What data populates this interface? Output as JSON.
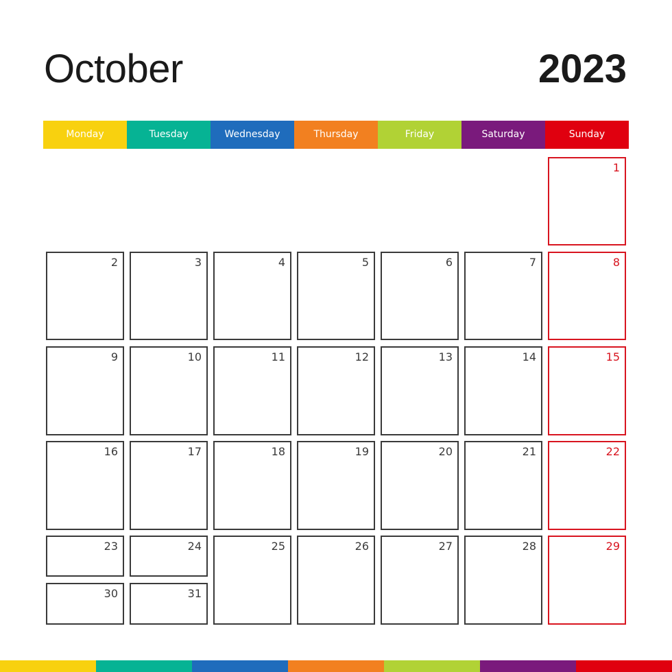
{
  "header": {
    "month": "October",
    "year": "2023"
  },
  "weekdays": [
    {
      "label": "Monday",
      "color": "#f8d10f"
    },
    {
      "label": "Tuesday",
      "color": "#06b394"
    },
    {
      "label": "Wednesday",
      "color": "#1f6cbc"
    },
    {
      "label": "Thursday",
      "color": "#f28020"
    },
    {
      "label": "Friday",
      "color": "#b1d235"
    },
    {
      "label": "Saturday",
      "color": "#7a1a7c"
    },
    {
      "label": "Sunday",
      "color": "#e0000f"
    }
  ],
  "colors": {
    "sunday_border": "#d8141f",
    "cell_border": "#3a3a3a",
    "text": "#1a1a1a"
  },
  "days": [
    {
      "day": "1",
      "col": 6,
      "row": 0
    },
    {
      "day": "2",
      "col": 0,
      "row": 1
    },
    {
      "day": "3",
      "col": 1,
      "row": 1
    },
    {
      "day": "4",
      "col": 2,
      "row": 1
    },
    {
      "day": "5",
      "col": 3,
      "row": 1
    },
    {
      "day": "6",
      "col": 4,
      "row": 1
    },
    {
      "day": "7",
      "col": 5,
      "row": 1
    },
    {
      "day": "8",
      "col": 6,
      "row": 1
    },
    {
      "day": "9",
      "col": 0,
      "row": 2
    },
    {
      "day": "10",
      "col": 1,
      "row": 2
    },
    {
      "day": "11",
      "col": 2,
      "row": 2
    },
    {
      "day": "12",
      "col": 3,
      "row": 2
    },
    {
      "day": "13",
      "col": 4,
      "row": 2
    },
    {
      "day": "14",
      "col": 5,
      "row": 2
    },
    {
      "day": "15",
      "col": 6,
      "row": 2
    },
    {
      "day": "16",
      "col": 0,
      "row": 3
    },
    {
      "day": "17",
      "col": 1,
      "row": 3
    },
    {
      "day": "18",
      "col": 2,
      "row": 3
    },
    {
      "day": "19",
      "col": 3,
      "row": 3
    },
    {
      "day": "20",
      "col": 4,
      "row": 3
    },
    {
      "day": "21",
      "col": 5,
      "row": 3
    },
    {
      "day": "22",
      "col": 6,
      "row": 3
    },
    {
      "day": "23",
      "col": 0,
      "row": 4,
      "half": "top"
    },
    {
      "day": "24",
      "col": 1,
      "row": 4,
      "half": "top"
    },
    {
      "day": "25",
      "col": 2,
      "row": 4
    },
    {
      "day": "26",
      "col": 3,
      "row": 4
    },
    {
      "day": "27",
      "col": 4,
      "row": 4
    },
    {
      "day": "28",
      "col": 5,
      "row": 4
    },
    {
      "day": "29",
      "col": 6,
      "row": 4
    },
    {
      "day": "30",
      "col": 0,
      "row": 4,
      "half": "bottom"
    },
    {
      "day": "31",
      "col": 1,
      "row": 4,
      "half": "bottom"
    }
  ]
}
